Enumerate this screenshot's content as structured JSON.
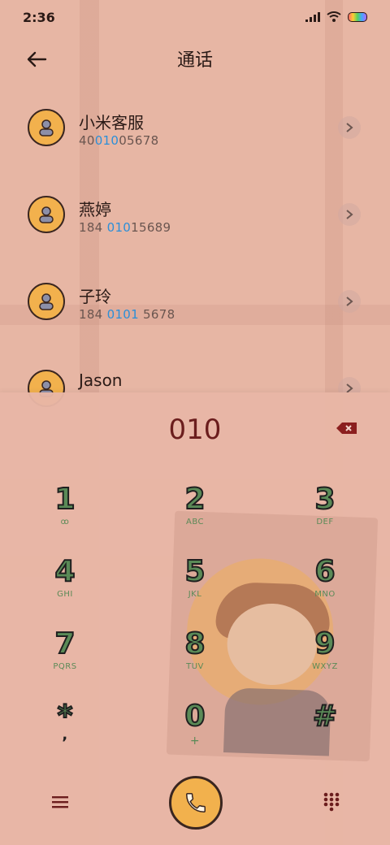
{
  "status": {
    "time": "2:36"
  },
  "header": {
    "title": "通话"
  },
  "contacts": [
    {
      "name": "小米客服",
      "num_pre": "40",
      "num_match": "010",
      "num_post": "05678"
    },
    {
      "name": "燕婷",
      "num_pre": "184 ",
      "num_match": "010",
      "num_post": "15689"
    },
    {
      "name": "子玲",
      "num_pre": "184 ",
      "num_match": "0101",
      "num_post": " 5678"
    },
    {
      "name": "Jason",
      "num_pre": "",
      "num_match": "",
      "num_post": ""
    }
  ],
  "dial": {
    "display": "010",
    "keys": [
      {
        "num": "1",
        "sub": "ꝏ"
      },
      {
        "num": "2",
        "sub": "ABC"
      },
      {
        "num": "3",
        "sub": "DEF"
      },
      {
        "num": "4",
        "sub": "GHI"
      },
      {
        "num": "5",
        "sub": "JKL"
      },
      {
        "num": "6",
        "sub": "MNO"
      },
      {
        "num": "7",
        "sub": "PQRS"
      },
      {
        "num": "8",
        "sub": "TUV"
      },
      {
        "num": "9",
        "sub": "WXYZ"
      },
      {
        "num": "*",
        "sub": ","
      },
      {
        "num": "0",
        "sub": "+"
      },
      {
        "num": "#",
        "sub": ""
      }
    ]
  },
  "icons": {
    "back": "arrow-left-icon",
    "avatar": "person-icon",
    "chevron": "chevron-right-icon",
    "delete": "backspace-icon",
    "menu": "menu-icon",
    "call": "phone-icon",
    "dialpad": "dialpad-icon"
  },
  "colors": {
    "accent": "#f2b14d",
    "highlight": "#2c8fd8",
    "digit_green": "#5a8a57",
    "display": "#6b1d1d"
  }
}
